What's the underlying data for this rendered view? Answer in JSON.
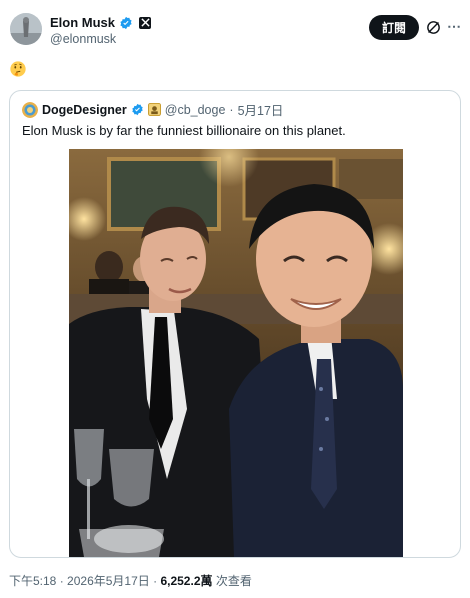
{
  "author": {
    "display_name": "Elon Musk",
    "handle": "@elonmusk"
  },
  "actions": {
    "follow_label": "訂閱"
  },
  "post": {
    "text_emoji": "🤔"
  },
  "quote": {
    "display_name": "DogeDesigner",
    "handle": "@cb_doge",
    "separator": "·",
    "date": "5月17日",
    "text": "Elon Musk is by far the funniest billionaire on this planet."
  },
  "meta": {
    "time": "下午5:18",
    "separator": "·",
    "date": "2026年5月17日",
    "views_count": "6,252.2萬",
    "views_label": "次查看"
  },
  "colors": {
    "verified_blue": "#1d9bf0",
    "text_primary": "#0f1419",
    "text_secondary": "#536471",
    "border": "#cfd9de"
  }
}
